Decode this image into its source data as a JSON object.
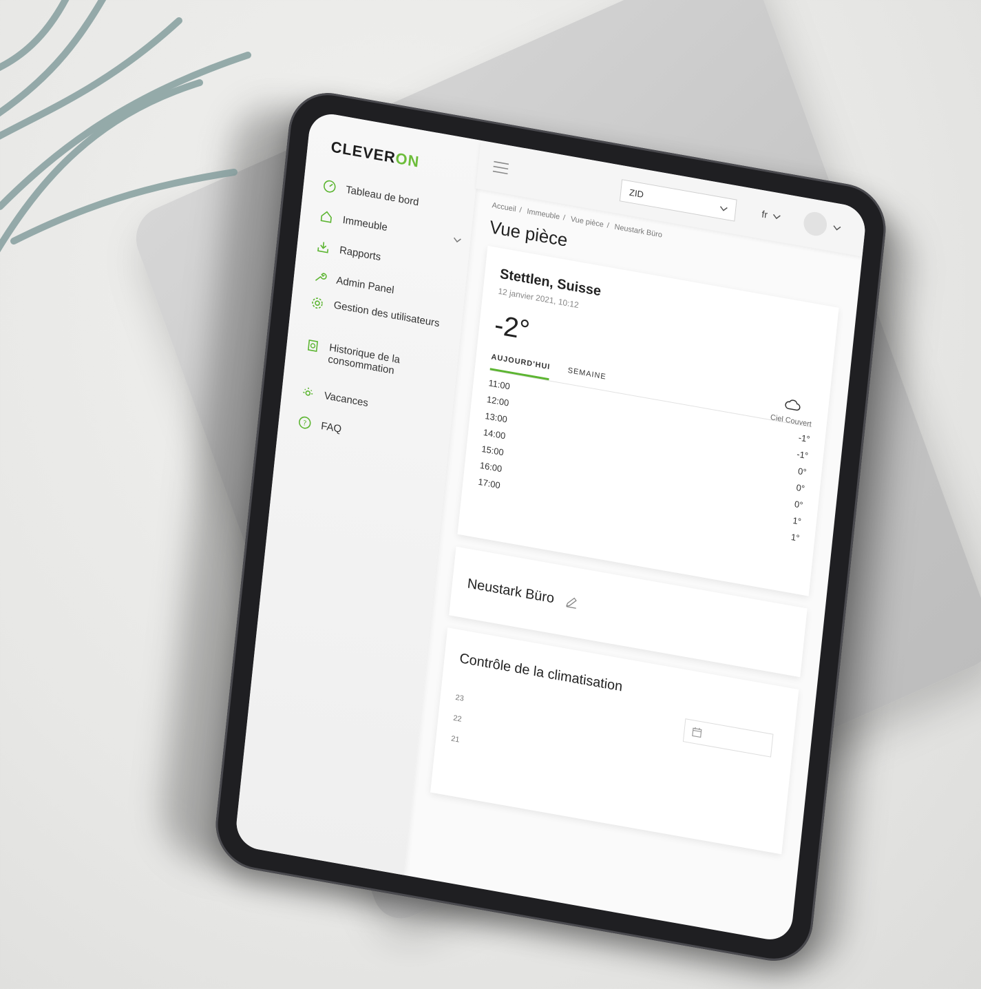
{
  "brand": {
    "prefix": "CLEVER",
    "suffix": "ON",
    "accent": "#5cb531"
  },
  "sidebar": {
    "items": [
      {
        "label": "Tableau de bord",
        "icon": "dashboard-icon"
      },
      {
        "label": "Immeuble",
        "icon": "home-icon",
        "has_submenu": true
      },
      {
        "label": "Rapports",
        "icon": "download-report-icon"
      },
      {
        "label": "Admin Panel",
        "icon": "wrench-icon"
      },
      {
        "label": "Gestion des utilisateurs",
        "icon": "gear-icon"
      },
      {
        "label": "Historique de la consommation",
        "icon": "history-icon"
      },
      {
        "label": "Vacances",
        "icon": "sun-icon"
      },
      {
        "label": "FAQ",
        "icon": "help-icon"
      }
    ]
  },
  "topbar": {
    "building_select": "ZID",
    "language": "fr"
  },
  "breadcrumbs": [
    "Accueil",
    "Immeuble",
    "Vue pièce",
    "Neustark Büro"
  ],
  "page_title": "Vue pièce",
  "weather": {
    "city": "Stettlen, Suisse",
    "datetime": "12 janvier 2021, 10:12",
    "temperature": "-2°",
    "tabs": [
      "AUJOURD'HUI",
      "SEMAINE"
    ],
    "active_tab": "AUJOURD'HUI",
    "condition": "Ciel Couvert",
    "hours": [
      {
        "time": "11:00",
        "temp": "-1°"
      },
      {
        "time": "12:00",
        "temp": "-1°"
      },
      {
        "time": "13:00",
        "temp": "0°"
      },
      {
        "time": "14:00",
        "temp": "0°"
      },
      {
        "time": "15:00",
        "temp": "0°"
      },
      {
        "time": "16:00",
        "temp": "1°"
      },
      {
        "time": "17:00",
        "temp": "1°"
      }
    ]
  },
  "room": {
    "name": "Neustark Büro"
  },
  "climate": {
    "title": "Contrôle de la climatisation",
    "y_ticks": [
      "23",
      "22",
      "21"
    ]
  }
}
